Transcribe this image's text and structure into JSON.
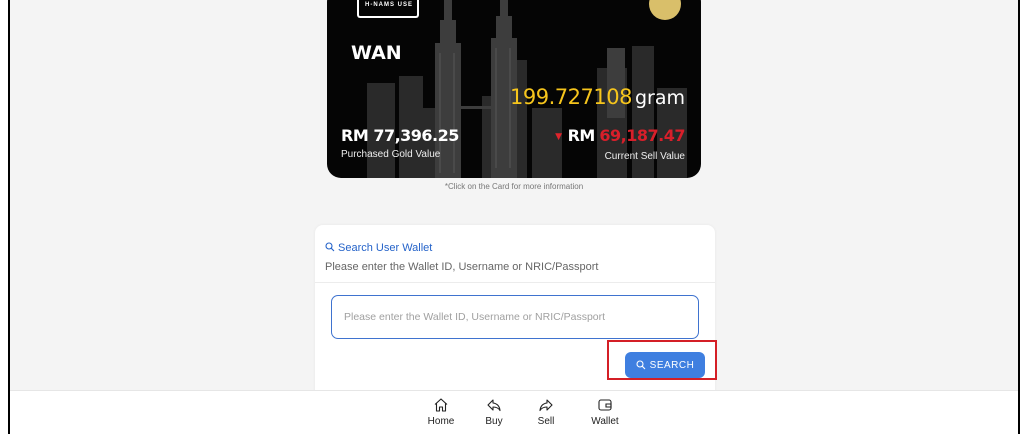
{
  "card": {
    "logo_text": "H-NAMS USE",
    "holder_name": "WAN",
    "grams_value": "199.727108",
    "grams_unit": "gram",
    "purchased_value": "RM 77,396.25",
    "purchased_label": "Purchased Gold Value",
    "sell_prefix": "RM",
    "sell_amount": "69,187.47",
    "sell_label": "Current Sell Value",
    "hint": "*Click on the Card for more information"
  },
  "search": {
    "title": "Search User Wallet",
    "subtitle": "Please enter the Wallet ID, Username or NRIC/Passport",
    "placeholder": "Please enter the Wallet ID, Username or NRIC/Passport",
    "button_label": "SEARCH"
  },
  "nav": {
    "items": [
      {
        "label": "Home",
        "icon": "home-icon"
      },
      {
        "label": "Buy",
        "icon": "share-back-icon"
      },
      {
        "label": "Sell",
        "icon": "share-forward-icon"
      },
      {
        "label": "Wallet",
        "icon": "wallet-icon"
      }
    ]
  },
  "colors": {
    "accent": "#3f7fe0",
    "gold": "#f6c51c",
    "down": "#d81f2a",
    "highlight": "#d41f26"
  }
}
